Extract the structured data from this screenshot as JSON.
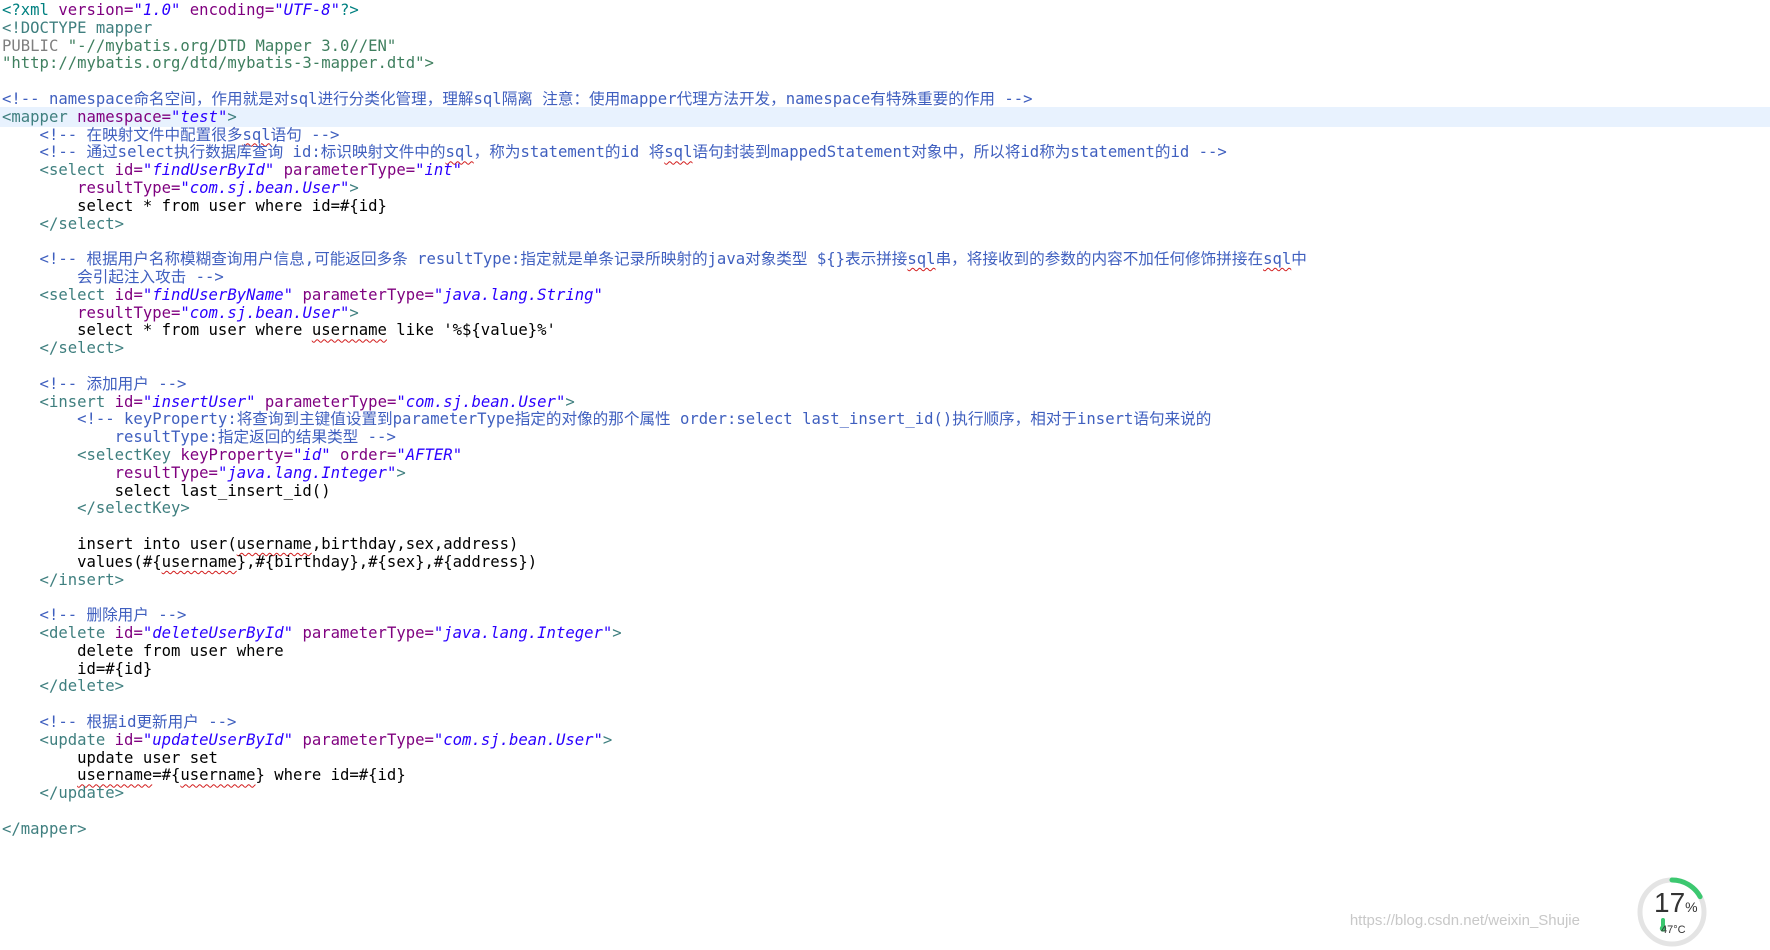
{
  "editor": {
    "lines": [
      [
        {
          "t": "<?xml ",
          "c": "pi"
        },
        {
          "t": "version=",
          "c": "attr"
        },
        {
          "t": "\"1.0\"",
          "c": "val"
        },
        {
          "t": " ",
          "c": "txt"
        },
        {
          "t": "encoding=",
          "c": "attr"
        },
        {
          "t": "\"UTF-8\"",
          "c": "val"
        },
        {
          "t": "?>",
          "c": "pi"
        }
      ],
      [
        {
          "t": "<!DOCTYPE mapper",
          "c": "tag"
        }
      ],
      [
        {
          "t": "PUBLIC ",
          "c": "doc"
        },
        {
          "t": "\"-//mybatis.org/DTD Mapper 3.0//EN\"",
          "c": "str"
        }
      ],
      [
        {
          "t": "\"http://mybatis.org/dtd/mybatis-3-mapper.dtd\">",
          "c": "str"
        }
      ],
      [],
      [
        {
          "t": "<!-- ",
          "c": "com"
        },
        {
          "t": "namespace",
          "c": "com",
          "e": true
        },
        {
          "t": "命名空间，作用就是对",
          "c": "com"
        },
        {
          "t": "sql",
          "c": "com",
          "e": true
        },
        {
          "t": "进行分类化管理，理解",
          "c": "com"
        },
        {
          "t": "sql",
          "c": "com",
          "e": true
        },
        {
          "t": "隔离 注意：使用",
          "c": "com"
        },
        {
          "t": "mapper",
          "c": "com",
          "e": true
        },
        {
          "t": "代理方法开发，",
          "c": "com"
        },
        {
          "t": "namespace",
          "c": "com",
          "e": true
        },
        {
          "t": "有特殊重要的作用 -->",
          "c": "com"
        }
      ],
      [
        {
          "t": "<mapper ",
          "c": "tag"
        },
        {
          "t": "namespace=",
          "c": "attr"
        },
        {
          "t": "\"test\"",
          "c": "val"
        },
        {
          "t": ">",
          "c": "tag"
        }
      ],
      [
        {
          "t": "    <!-- 在映射文件中配置很多",
          "c": "com"
        },
        {
          "t": "sql",
          "c": "com",
          "e": true
        },
        {
          "t": "语句 -->",
          "c": "com"
        }
      ],
      [
        {
          "t": "    <!-- 通过select执行数据库查询 id:标识映射文件中的",
          "c": "com"
        },
        {
          "t": "sql",
          "c": "com",
          "e": true
        },
        {
          "t": "，称为statement的id 将",
          "c": "com"
        },
        {
          "t": "sql",
          "c": "com",
          "e": true
        },
        {
          "t": "语句封装到mappedStatement对象中，所以将id称为statement的id -->",
          "c": "com"
        }
      ],
      [
        {
          "t": "    <select ",
          "c": "tag"
        },
        {
          "t": "id=",
          "c": "attr"
        },
        {
          "t": "\"findUserById\"",
          "c": "val"
        },
        {
          "t": " ",
          "c": "txt"
        },
        {
          "t": "parameterType=",
          "c": "attr"
        },
        {
          "t": "\"int\"",
          "c": "val"
        }
      ],
      [
        {
          "t": "        ",
          "c": "txt"
        },
        {
          "t": "resultType=",
          "c": "attr"
        },
        {
          "t": "\"com.sj.bean.User\"",
          "c": "val"
        },
        {
          "t": ">",
          "c": "tag"
        }
      ],
      [
        {
          "t": "        select * from user where id=#{id}",
          "c": "txt"
        }
      ],
      [
        {
          "t": "    </select>",
          "c": "tag"
        }
      ],
      [],
      [
        {
          "t": "    <!-- 根据用户名称模糊查询用户信息,可能返回多条 resultType:指定就是单条记录所映射的java对象类型 ${}表示拼接",
          "c": "com"
        },
        {
          "t": "sql",
          "c": "com",
          "e": true
        },
        {
          "t": "串，将接收到的参数的内容不加任何修饰拼接在",
          "c": "com"
        },
        {
          "t": "sql",
          "c": "com",
          "e": true
        },
        {
          "t": "中",
          "c": "com"
        }
      ],
      [
        {
          "t": "        会引起注入攻击 -->",
          "c": "com"
        }
      ],
      [
        {
          "t": "    <select ",
          "c": "tag"
        },
        {
          "t": "id=",
          "c": "attr"
        },
        {
          "t": "\"findUserByName\"",
          "c": "val"
        },
        {
          "t": " ",
          "c": "txt"
        },
        {
          "t": "parameterType=",
          "c": "attr"
        },
        {
          "t": "\"java.lang.String\"",
          "c": "val"
        }
      ],
      [
        {
          "t": "        ",
          "c": "txt"
        },
        {
          "t": "resultType=",
          "c": "attr"
        },
        {
          "t": "\"com.sj.bean.User\"",
          "c": "val"
        },
        {
          "t": ">",
          "c": "tag"
        }
      ],
      [
        {
          "t": "        select * from user where ",
          "c": "txt"
        },
        {
          "t": "username",
          "c": "txt",
          "e": true
        },
        {
          "t": " like '%${value}%'",
          "c": "txt"
        }
      ],
      [
        {
          "t": "    </select>",
          "c": "tag"
        }
      ],
      [],
      [
        {
          "t": "    <!-- 添加用户 -->",
          "c": "com"
        }
      ],
      [
        {
          "t": "    <insert ",
          "c": "tag"
        },
        {
          "t": "id=",
          "c": "attr"
        },
        {
          "t": "\"insertUser\"",
          "c": "val"
        },
        {
          "t": " ",
          "c": "txt"
        },
        {
          "t": "parameterType=",
          "c": "attr"
        },
        {
          "t": "\"com.sj.bean.User\"",
          "c": "val"
        },
        {
          "t": ">",
          "c": "tag"
        }
      ],
      [
        {
          "t": "        <!-- keyProperty:将查询到主键值设置到parameterType指定的对像的那个属性 order:select last_insert_id()执行顺序，相对于insert语句来说的",
          "c": "com"
        }
      ],
      [
        {
          "t": "            resultType:指定返回的结果类型 -->",
          "c": "com"
        }
      ],
      [
        {
          "t": "        <selectKey ",
          "c": "tag"
        },
        {
          "t": "keyProperty=",
          "c": "attr"
        },
        {
          "t": "\"id\"",
          "c": "val"
        },
        {
          "t": " ",
          "c": "txt"
        },
        {
          "t": "order=",
          "c": "attr"
        },
        {
          "t": "\"AFTER\"",
          "c": "val"
        }
      ],
      [
        {
          "t": "            ",
          "c": "txt"
        },
        {
          "t": "resultType=",
          "c": "attr"
        },
        {
          "t": "\"java.lang.Integer\"",
          "c": "val"
        },
        {
          "t": ">",
          "c": "tag"
        }
      ],
      [
        {
          "t": "            select last_insert_id()",
          "c": "txt"
        }
      ],
      [
        {
          "t": "        </selectKey>",
          "c": "tag"
        }
      ],
      [],
      [
        {
          "t": "        insert into user(",
          "c": "txt"
        },
        {
          "t": "username",
          "c": "txt",
          "e": true
        },
        {
          "t": ",birthday,sex,address)",
          "c": "txt"
        }
      ],
      [
        {
          "t": "        values(#{",
          "c": "txt"
        },
        {
          "t": "username",
          "c": "txt",
          "e": true
        },
        {
          "t": "},#{birthday},#{sex},#{address})",
          "c": "txt"
        }
      ],
      [
        {
          "t": "    </insert>",
          "c": "tag"
        }
      ],
      [],
      [
        {
          "t": "    <!-- 删除用户 -->",
          "c": "com"
        }
      ],
      [
        {
          "t": "    <delete ",
          "c": "tag"
        },
        {
          "t": "id=",
          "c": "attr"
        },
        {
          "t": "\"deleteUserById\"",
          "c": "val"
        },
        {
          "t": " ",
          "c": "txt"
        },
        {
          "t": "parameterType=",
          "c": "attr"
        },
        {
          "t": "\"java.lang.Integer\"",
          "c": "val"
        },
        {
          "t": ">",
          "c": "tag"
        }
      ],
      [
        {
          "t": "        delete from user where",
          "c": "txt"
        }
      ],
      [
        {
          "t": "        id=#{id}",
          "c": "txt"
        }
      ],
      [
        {
          "t": "    </delete>",
          "c": "tag"
        }
      ],
      [],
      [
        {
          "t": "    <!-- 根据id更新用户 -->",
          "c": "com"
        }
      ],
      [
        {
          "t": "    <update ",
          "c": "tag"
        },
        {
          "t": "id=",
          "c": "attr"
        },
        {
          "t": "\"updateUserById\"",
          "c": "val"
        },
        {
          "t": " ",
          "c": "txt"
        },
        {
          "t": "parameterType=",
          "c": "attr"
        },
        {
          "t": "\"com.sj.bean.User\"",
          "c": "val"
        },
        {
          "t": ">",
          "c": "tag"
        }
      ],
      [
        {
          "t": "        update user set",
          "c": "txt"
        }
      ],
      [
        {
          "t": "        ",
          "c": "txt"
        },
        {
          "t": "username",
          "c": "txt",
          "e": true
        },
        {
          "t": "=#{",
          "c": "txt"
        },
        {
          "t": "username",
          "c": "txt",
          "e": true
        },
        {
          "t": "} where id=#{id}",
          "c": "txt"
        }
      ],
      [
        {
          "t": "    </update>",
          "c": "tag"
        }
      ],
      [],
      [
        {
          "t": "</mapper>",
          "c": "tag"
        }
      ]
    ],
    "current_line": 6,
    "colors": {
      "pi": "#008080",
      "tag": "#3f7f7f",
      "attr": "#7f007f",
      "val": "#2a00ff",
      "comment": "#3f5fbf",
      "doctype_string": "#3f7f5f",
      "current_line_bg": "#e8f2fe",
      "spell_error": "#d21d1d"
    }
  },
  "watermark": "https://blog.csdn.net/weixin_Shujie",
  "cpu_widget": {
    "percent": "17",
    "percent_sign": "%",
    "percent_value": 17,
    "temperature": "47°C",
    "ring_color": "#3cc870",
    "icon": "thermometer-icon"
  }
}
